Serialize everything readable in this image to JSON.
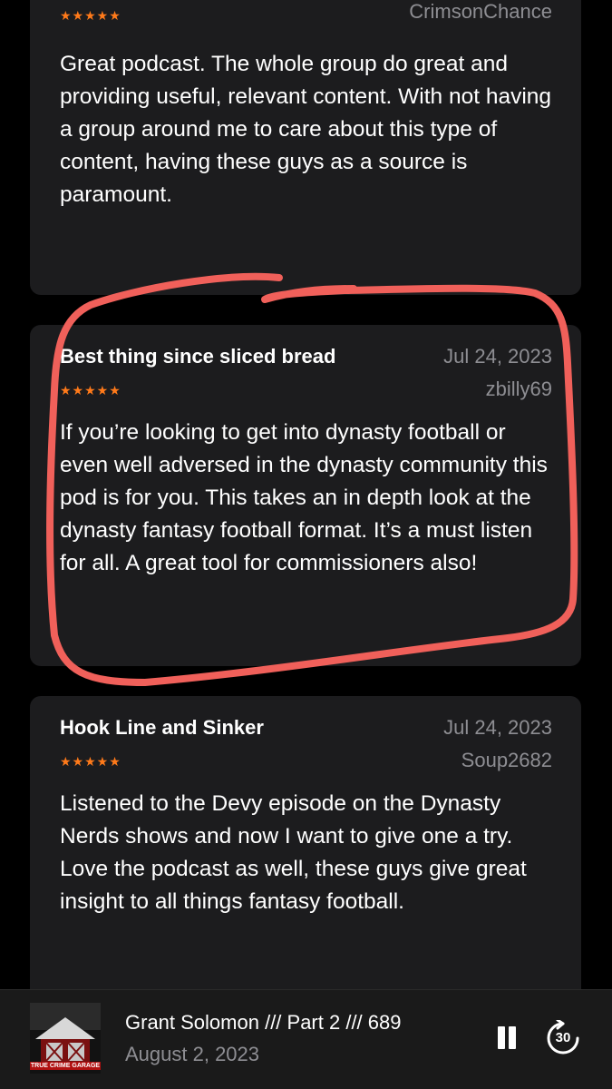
{
  "reviews": [
    {
      "stars": "★★★★★",
      "author": "CrimsonChance",
      "body": "Great podcast. The whole group do great and providing useful, relevant content. With not having a group around me to care about this type of content, having these guys as a source is paramount."
    },
    {
      "title": "Best thing since sliced bread",
      "date": "Jul 24, 2023",
      "stars": "★★★★★",
      "author": "zbilly69",
      "body": "If you’re looking to get into dynasty football or even well adversed in the dynasty community this pod is for you. This takes an in depth look at the dynasty fantasy football format. It’s a must listen for all. A great tool for commissioners also!"
    },
    {
      "title": "Hook Line and Sinker",
      "date": "Jul 24, 2023",
      "stars": "★★★★★",
      "author": "Soup2682",
      "body": "Listened to the Devy episode on the Dynasty Nerds shows and now I want to give one a try. Love the podcast as well, these guys give great insight to all things fantasy football."
    }
  ],
  "player": {
    "episode_title": "Grant Solomon /// Part 2 /// 689",
    "episode_date": "August 2, 2023",
    "artwork_caption": "TRUE CRIME GARAGE",
    "skip_label": "30",
    "pause_icon": "pause-icon",
    "skip_icon": "skip-forward-30-icon"
  },
  "colors": {
    "background": "#000000",
    "card": "#1c1c1e",
    "stars": "#ff7a1a",
    "secondary_text": "#8e8e93",
    "annotation": "#f0605a"
  }
}
